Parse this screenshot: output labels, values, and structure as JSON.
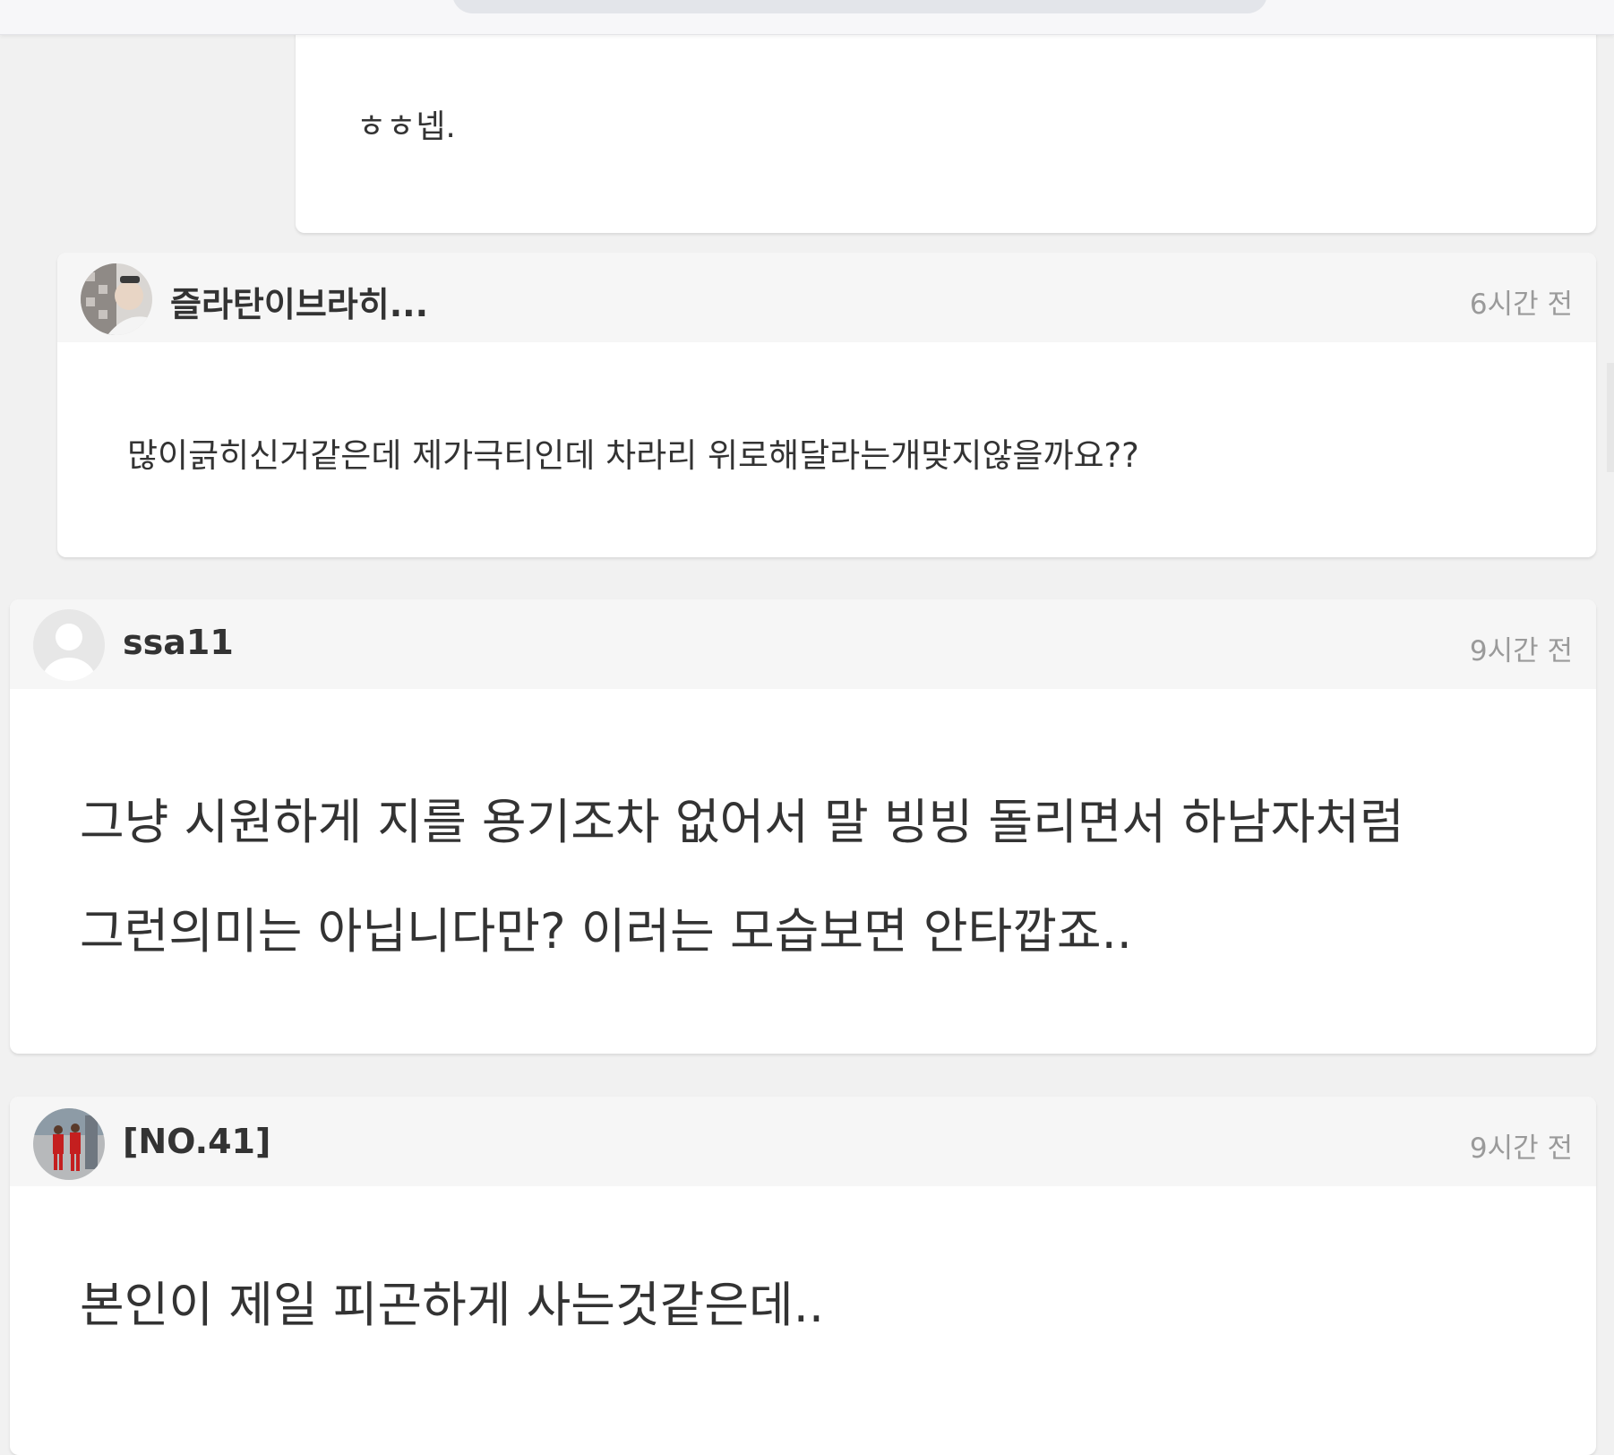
{
  "comments": [
    {
      "body": "ㅎㅎ넵."
    },
    {
      "username": "즐라탄이브라히...",
      "time": "6시간 전",
      "body": "많이긁히신거같은데 제가극티인데 차라리 위로해달라는개맞지않을까요??"
    },
    {
      "username": "ssa11",
      "time": "9시간 전",
      "body_lines": [
        "그냥 시원하게 지를 용기조차 없어서 말 빙빙 돌리면서 하남자처럼",
        "그런의미는 아닙니다만? 이러는 모습보면 안타깝죠.."
      ]
    },
    {
      "username": "[NO.41]",
      "time": "9시간 전",
      "body": "본인이 제일 피곤하게 사는것같은데.."
    }
  ],
  "colors": {
    "background": "#f1f1f1",
    "card": "#ffffff",
    "card_header": "#f6f6f6",
    "text": "#333333",
    "muted": "#9a9a9a"
  },
  "icons": [
    "avatar-photo-icon",
    "default-user-avatar-icon",
    "avatar-players-icon"
  ]
}
